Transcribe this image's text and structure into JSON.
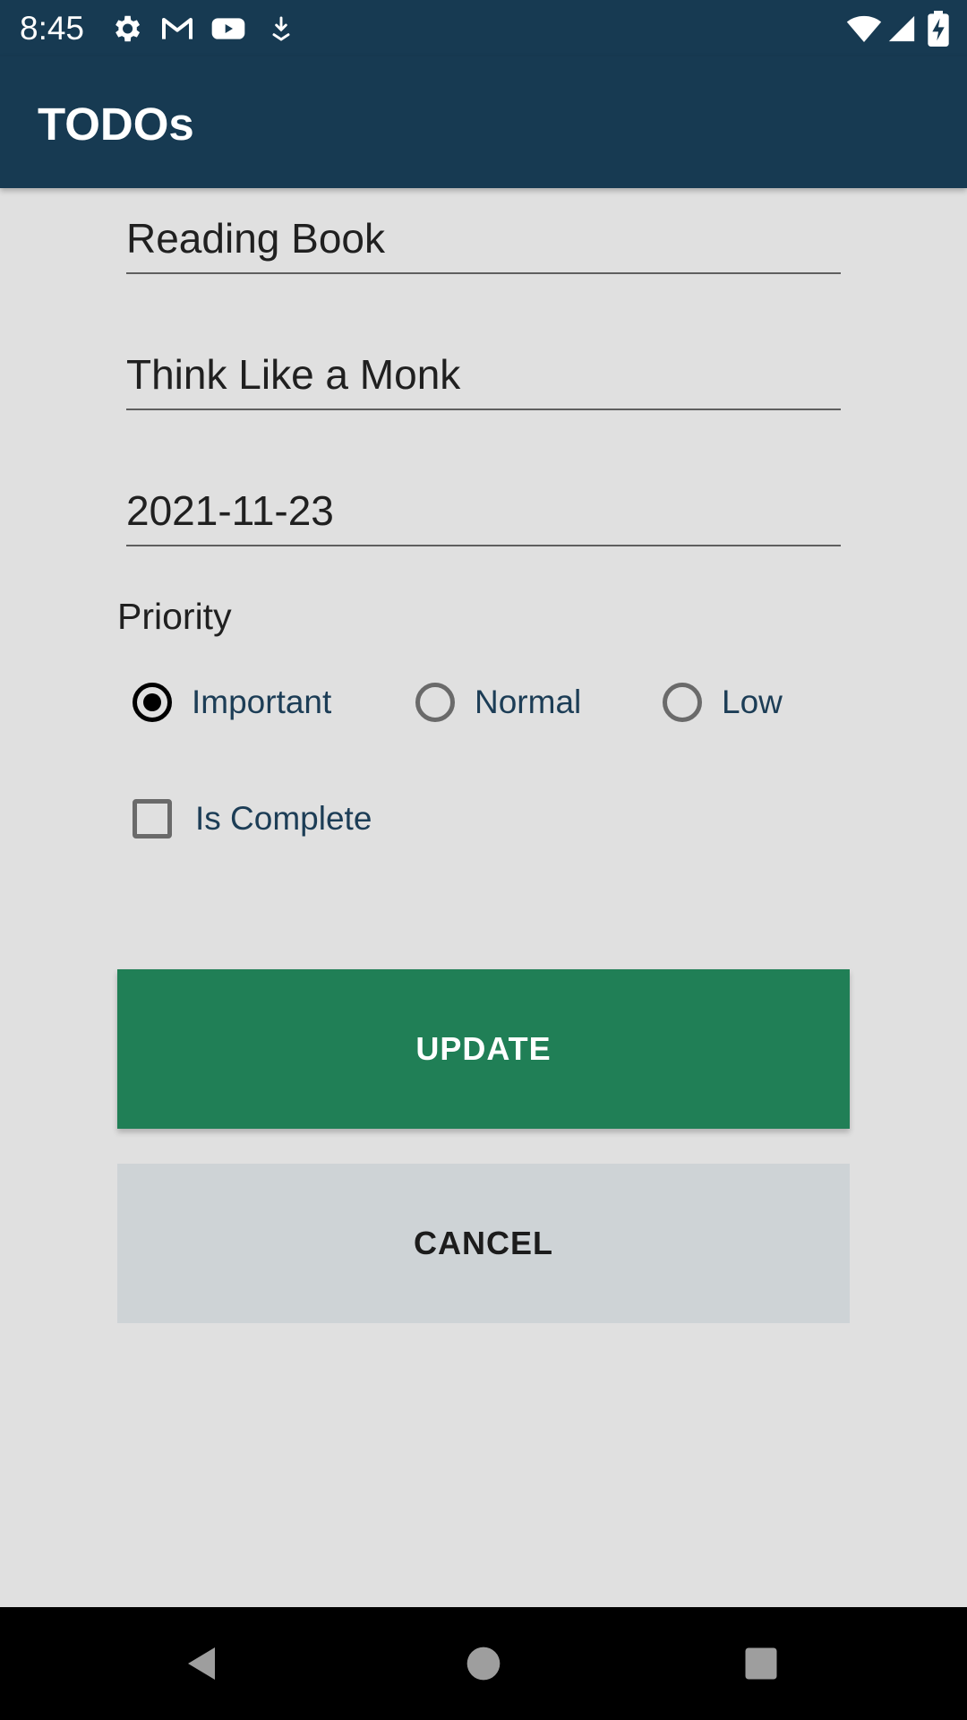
{
  "status_bar": {
    "time": "8:45",
    "icons": [
      "settings-icon",
      "gmail-icon",
      "youtube-icon",
      "download-icon",
      "wifi-icon",
      "signal-icon",
      "battery-charging-icon"
    ]
  },
  "app_bar": {
    "title": "TODOs"
  },
  "form": {
    "title_value": "Reading Book",
    "description_value": "Think Like a Monk",
    "date_value": "2021-11-23",
    "priority_label": "Priority",
    "priority_options": [
      {
        "label": "Important",
        "checked": true
      },
      {
        "label": "Normal",
        "checked": false
      },
      {
        "label": "Low",
        "checked": false
      }
    ],
    "is_complete_label": "Is Complete",
    "is_complete_checked": false
  },
  "buttons": {
    "update_label": "UPDATE",
    "cancel_label": "CANCEL"
  },
  "colors": {
    "app_bar": "#173a52",
    "update_button": "#207f56",
    "cancel_button": "#ced3d6",
    "background": "#e0e0e0"
  },
  "nav_bar": {
    "icons": [
      "back-icon",
      "home-icon",
      "recents-icon"
    ]
  }
}
